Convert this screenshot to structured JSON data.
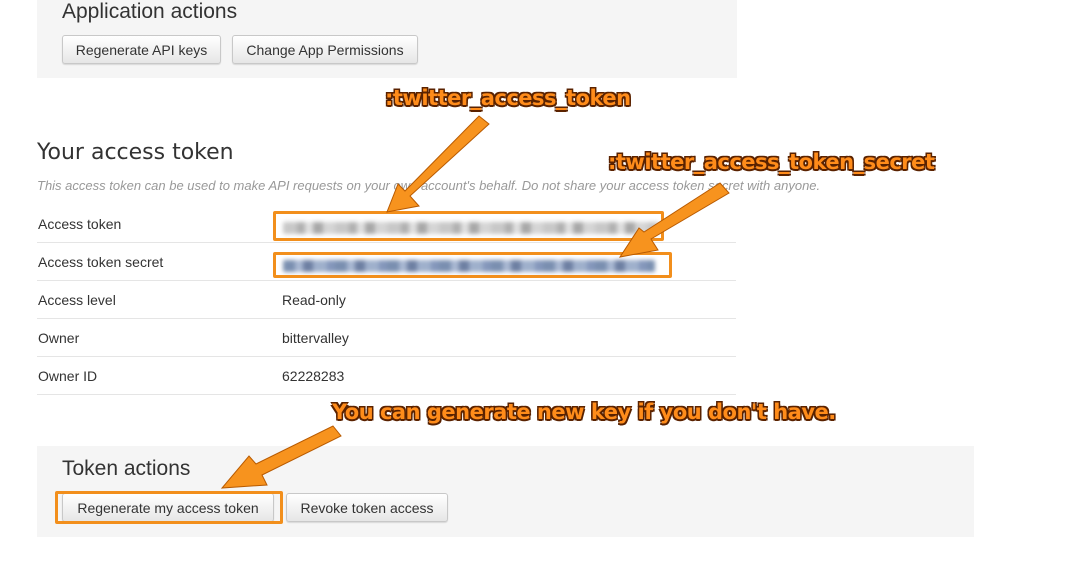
{
  "app_actions": {
    "title": "Application actions",
    "regenerate_keys_label": "Regenerate API keys",
    "change_permissions_label": "Change App Permissions"
  },
  "access_token": {
    "title": "Your access token",
    "description": "This access token can be used to make API requests on your own account's behalf. Do not share your access token secret with anyone.",
    "rows": [
      {
        "label": "Access token",
        "value": ""
      },
      {
        "label": "Access token secret",
        "value": ""
      },
      {
        "label": "Access level",
        "value": "Read-only"
      },
      {
        "label": "Owner",
        "value": "bittervalley"
      },
      {
        "label": "Owner ID",
        "value": "62228283"
      }
    ]
  },
  "token_actions": {
    "title": "Token actions",
    "regenerate_label": "Regenerate my access token",
    "revoke_label": "Revoke token access"
  },
  "annotations": {
    "token": ":twitter_access_token",
    "secret": ":twitter_access_token_secret",
    "generate": "You can generate new key if you don't have."
  },
  "colors": {
    "annotation_orange": "#f28f1c",
    "panel_bg": "#f5f5f5"
  }
}
